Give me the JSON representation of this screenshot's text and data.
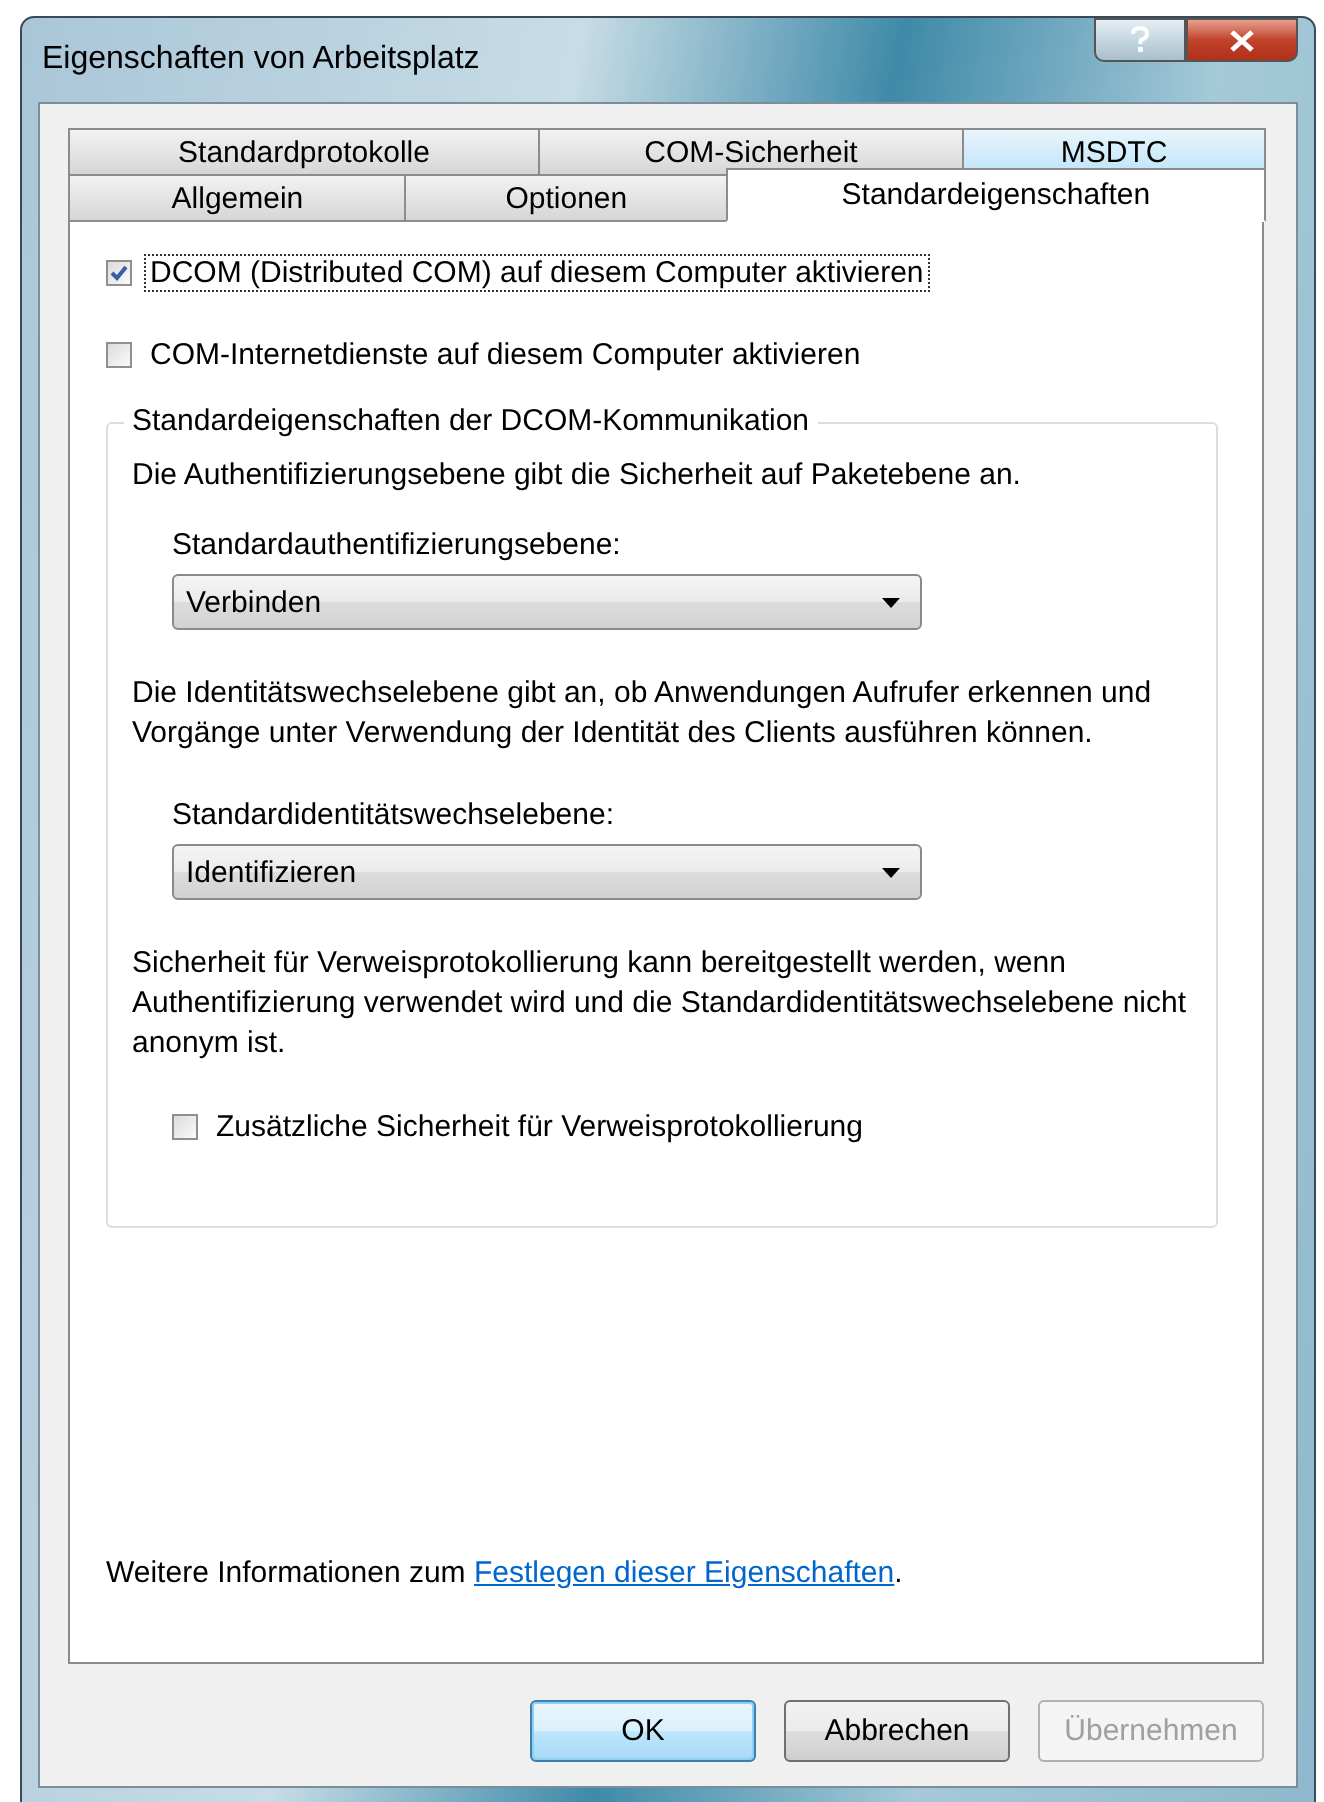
{
  "window": {
    "title": "Eigenschaften von Arbeitsplatz"
  },
  "tab_rows": [
    [
      {
        "label": "Standardprotokolle",
        "selected": false,
        "hover": false
      },
      {
        "label": "COM-Sicherheit",
        "selected": false,
        "hover": false
      },
      {
        "label": "MSDTC",
        "selected": false,
        "hover": true
      }
    ],
    [
      {
        "label": "Allgemein",
        "selected": false,
        "hover": false
      },
      {
        "label": "Optionen",
        "selected": false,
        "hover": false
      },
      {
        "label": "Standardeigenschaften",
        "selected": true,
        "hover": false
      }
    ]
  ],
  "options": [
    {
      "label": "DCOM (Distributed COM) auf diesem Computer aktivieren",
      "checked": true,
      "focused": true
    },
    {
      "label": "COM-Internetdienste auf diesem Computer aktivieren",
      "checked": false,
      "focused": false
    }
  ],
  "group": {
    "title": "Standardeigenschaften der DCOM-Kommunikation",
    "items": [
      {
        "kind": "text",
        "text": "Die Authentifizierungsebene gibt die Sicherheit auf Paketebene an."
      },
      {
        "kind": "combo",
        "label": "Standardauthentifizierungsebene:",
        "value": "Verbinden"
      },
      {
        "kind": "text",
        "text": "Die Identitätswechselebene gibt an, ob Anwendungen Aufrufer erkennen und Vorgänge unter Verwendung der Identität des Clients ausführen können."
      },
      {
        "kind": "combo",
        "label": "Standardidentitätswechselebene:",
        "value": "Identifizieren"
      },
      {
        "kind": "text",
        "text": "Sicherheit für Verweisprotokollierung kann bereitgestellt werden, wenn Authentifizierung verwendet wird und die Standardidentitätswechselebene nicht anonym ist."
      },
      {
        "kind": "checkbox",
        "label": "Zusätzliche Sicherheit für Verweisprotokollierung",
        "checked": false
      }
    ]
  },
  "footer": {
    "text": "Weitere Informationen zum ",
    "link": "Festlegen dieser Eigenschaften",
    "after": "."
  },
  "buttons": [
    {
      "label": "OK",
      "default": true,
      "disabled": false
    },
    {
      "label": "Abbrechen",
      "default": false,
      "disabled": false
    },
    {
      "label": "Übernehmen",
      "default": false,
      "disabled": true
    }
  ]
}
